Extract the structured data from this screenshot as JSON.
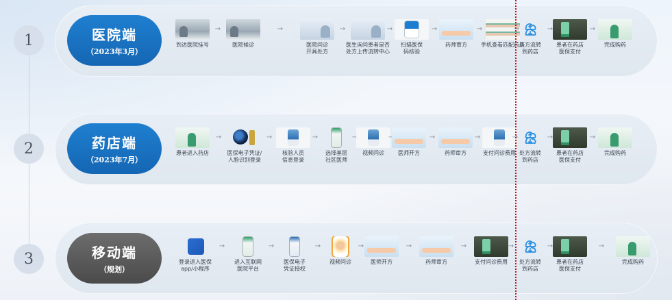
{
  "rows": [
    {
      "number": "1",
      "title": "医院端",
      "subtitle": "（2023年3月）",
      "style": "blue",
      "steps": [
        {
          "label": "到达医院挂号",
          "icon": "hospital-lobby-photo"
        },
        {
          "label": "医院候诊",
          "icon": "waiting-room-photo"
        },
        {
          "label": "医院问诊\n开具处方",
          "icon": "doctor-consultation-photo"
        },
        {
          "label": "医生询问患者是否\n处方上传流转中心",
          "icon": "doctor-patient-photo"
        },
        {
          "label": "扫描医保\n码核验",
          "icon": "scanner-kiosk-icon"
        },
        {
          "label": "药师审方",
          "icon": "pharmacist-review-photo"
        },
        {
          "label": "手机查看匹配药店",
          "icon": "pharmacy-shelf-photo"
        },
        {
          "label": "处方流转\n到药店",
          "icon": "cloud-transfer-icon"
        },
        {
          "label": "患者在药店\n医保支付",
          "icon": "payment-terminal-photo"
        },
        {
          "label": "完成购药",
          "icon": "pharmacy-counter-photo"
        }
      ]
    },
    {
      "number": "2",
      "title": "药店端",
      "subtitle": "（2023年7月）",
      "style": "blue",
      "steps": [
        {
          "label": "患者进入药店",
          "icon": "pharmacy-entrance-photo"
        },
        {
          "label": "医保电子凭证/\n人脸识别登录",
          "icon": "face-recognition-icon"
        },
        {
          "label": "核验人员\n信息登录",
          "icon": "verification-kiosk-icon"
        },
        {
          "label": "选择基层\n社区医师",
          "icon": "doctor-select-phone-icon"
        },
        {
          "label": "视频问诊",
          "icon": "video-kiosk-icon"
        },
        {
          "label": "医师开方",
          "icon": "doctor-prescribe-photo"
        },
        {
          "label": "药师审方",
          "icon": "pharmacist-review-photo"
        },
        {
          "label": "支付问诊费用",
          "icon": "payment-kiosk-icon"
        },
        {
          "label": "处方流转\n到药店",
          "icon": "cloud-transfer-icon"
        },
        {
          "label": "患者在药店\n医保支付",
          "icon": "payment-terminal-photo"
        },
        {
          "label": "完成购药",
          "icon": "pharmacy-counter-photo"
        }
      ]
    },
    {
      "number": "3",
      "title": "移动端",
      "subtitle": "（规划）",
      "style": "gray",
      "steps": [
        {
          "label": "登录进入医保\napp/小程序",
          "icon": "chs-app-icon"
        },
        {
          "label": "进入互联网\n医院平台",
          "icon": "internet-hospital-phone-icon"
        },
        {
          "label": "医保电子\n凭证授权",
          "icon": "insurance-credential-phone-icon"
        },
        {
          "label": "视频问诊",
          "icon": "video-call-phone-icon"
        },
        {
          "label": "医师开方",
          "icon": "doctor-prescribe-photo"
        },
        {
          "label": "药师审方",
          "icon": "pharmacist-review-photo"
        },
        {
          "label": "支付问诊费用",
          "icon": "mobile-payment-photo"
        },
        {
          "label": "处方流转\n到药店",
          "icon": "cloud-transfer-icon"
        },
        {
          "label": "患者在药店\n医保支付",
          "icon": "payment-terminal-photo"
        },
        {
          "label": "完成购药",
          "icon": "pharmacy-counter-photo"
        }
      ]
    }
  ],
  "colors": {
    "pill_blue": "#1670be",
    "pill_gray": "#5a5a5a",
    "divider_line": "#c4121f",
    "cloud_icon": "#2a8fe0"
  }
}
